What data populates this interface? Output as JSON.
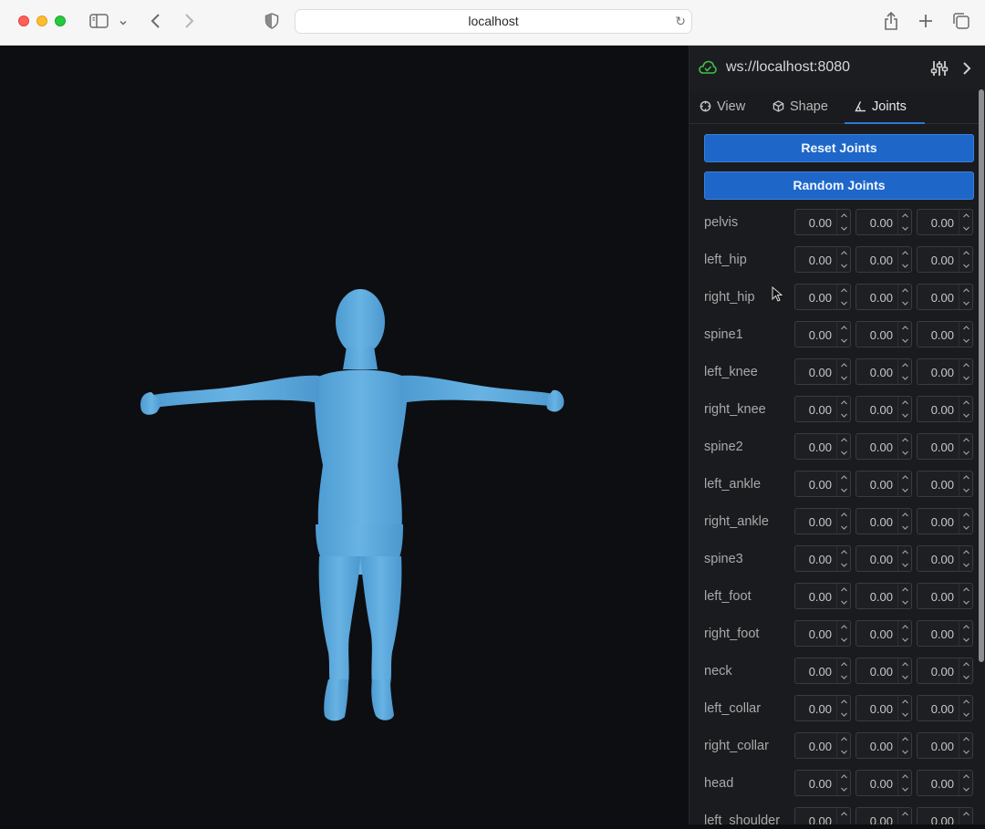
{
  "browser": {
    "url": "localhost"
  },
  "panel": {
    "connection": "ws://localhost:8080",
    "tabs": [
      {
        "label": "View"
      },
      {
        "label": "Shape"
      },
      {
        "label": "Joints"
      }
    ],
    "buttons": {
      "reset": "Reset Joints",
      "random": "Random Joints"
    },
    "joints": [
      {
        "name": "pelvis",
        "values": [
          "0.00",
          "0.00",
          "0.00"
        ]
      },
      {
        "name": "left_hip",
        "values": [
          "0.00",
          "0.00",
          "0.00"
        ]
      },
      {
        "name": "right_hip",
        "values": [
          "0.00",
          "0.00",
          "0.00"
        ]
      },
      {
        "name": "spine1",
        "values": [
          "0.00",
          "0.00",
          "0.00"
        ]
      },
      {
        "name": "left_knee",
        "values": [
          "0.00",
          "0.00",
          "0.00"
        ]
      },
      {
        "name": "right_knee",
        "values": [
          "0.00",
          "0.00",
          "0.00"
        ]
      },
      {
        "name": "spine2",
        "values": [
          "0.00",
          "0.00",
          "0.00"
        ]
      },
      {
        "name": "left_ankle",
        "values": [
          "0.00",
          "0.00",
          "0.00"
        ]
      },
      {
        "name": "right_ankle",
        "values": [
          "0.00",
          "0.00",
          "0.00"
        ]
      },
      {
        "name": "spine3",
        "values": [
          "0.00",
          "0.00",
          "0.00"
        ]
      },
      {
        "name": "left_foot",
        "values": [
          "0.00",
          "0.00",
          "0.00"
        ]
      },
      {
        "name": "right_foot",
        "values": [
          "0.00",
          "0.00",
          "0.00"
        ]
      },
      {
        "name": "neck",
        "values": [
          "0.00",
          "0.00",
          "0.00"
        ]
      },
      {
        "name": "left_collar",
        "values": [
          "0.00",
          "0.00",
          "0.00"
        ]
      },
      {
        "name": "right_collar",
        "values": [
          "0.00",
          "0.00",
          "0.00"
        ]
      },
      {
        "name": "head",
        "values": [
          "0.00",
          "0.00",
          "0.00"
        ]
      },
      {
        "name": "left_shoulder",
        "values": [
          "0.00",
          "0.00",
          "0.00"
        ]
      }
    ]
  },
  "colors": {
    "accent": "#1e67c9",
    "connected": "#3fbf4a",
    "model": "#5aa9dd"
  }
}
